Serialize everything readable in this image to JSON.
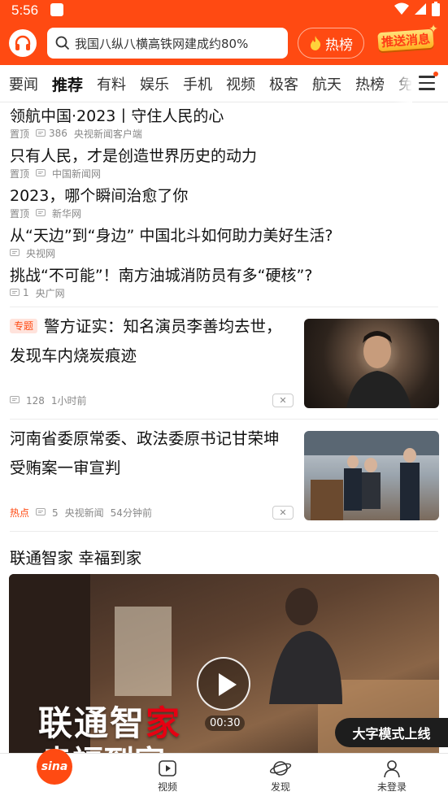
{
  "status_bar": {
    "time": "5:56"
  },
  "header": {
    "search_placeholder": "我国八纵八横高铁网建成约80%",
    "hot_label": "热榜",
    "push_label": "推送消息"
  },
  "tabs": [
    "要闻",
    "推荐",
    "有料",
    "娱乐",
    "手机",
    "视频",
    "极客",
    "航天",
    "热榜",
    "免"
  ],
  "active_tab": "推荐",
  "headlines": [
    {
      "title": "领航中国·2023丨守住人民的心",
      "pinned": "置顶",
      "comments": "386",
      "source": "央视新闻客户端"
    },
    {
      "title": "只有人民，才是创造世界历史的动力",
      "pinned": "置顶",
      "comments": "",
      "source": "中国新闻网"
    },
    {
      "title": "2023，哪个瞬间治愈了你",
      "pinned": "置顶",
      "comments": "",
      "source": "新华网"
    },
    {
      "title": "从“天边”到“身边” 中国北斗如何助力美好生活?",
      "pinned": "",
      "comments": "",
      "source": "央视网"
    },
    {
      "title": "挑战“不可能”！南方油城消防员有多“硬核”?",
      "pinned": "",
      "comments": "1",
      "source": "央广网"
    }
  ],
  "cards": [
    {
      "tag": "专题",
      "title": "警方证实：知名演员李善均去世，发现车内烧炭痕迹",
      "comments": "128",
      "source": "",
      "time": "1小时前",
      "close": "✕"
    },
    {
      "tag": "热点",
      "title": "河南省委原常委、政法委原书记甘荣坤受贿案一审宣判",
      "comments": "5",
      "source": "央视新闻",
      "time": "54分钟前",
      "close": "✕"
    }
  ],
  "ad": {
    "title": "联通智家 幸福到家",
    "duration": "00:30",
    "slogan_a": "联通智",
    "slogan_b": "家",
    "slogan_c": "幸福到家"
  },
  "toast": "大字模式上线",
  "bottom_nav": {
    "home": "sina",
    "video": "视频",
    "discover": "发现",
    "login": "未登录"
  },
  "colors": {
    "brand": "#ff4a12",
    "tag_bg": "#ffe3dc"
  }
}
